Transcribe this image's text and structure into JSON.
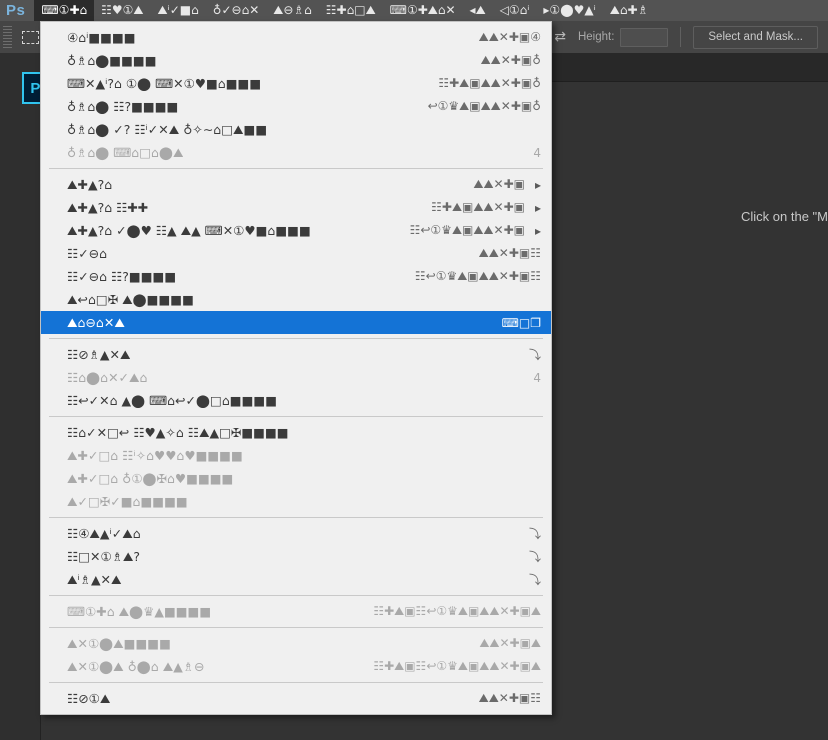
{
  "app": {
    "wordmark": "Ps",
    "home_button_label": "Ps"
  },
  "menubar": {
    "items": [
      {
        "label": "⌨①✚⌂",
        "active": true
      },
      {
        "label": "☷♥①⛰",
        "active": false
      },
      {
        "label": "⛰ⁱ✓■⌂",
        "active": false
      },
      {
        "label": "♁✓⊖⌂✕",
        "active": false
      },
      {
        "label": "⛰⊖♗⌂",
        "active": false
      },
      {
        "label": "☷✚⌂□⛰",
        "active": false
      },
      {
        "label": "⌨①✚⛰⌂✕",
        "active": false
      },
      {
        "label": "◂⛰",
        "active": false
      },
      {
        "label": "◁①⌂ⁱ",
        "active": false
      },
      {
        "label": "▸①⬤♥▲ⁱ",
        "active": false
      },
      {
        "label": "⛰⌂✚♗",
        "active": false
      }
    ]
  },
  "optionsbar": {
    "grip_icon": "drag-grip-icon",
    "tool_icon": "rectangular-marquee-icon",
    "width_value": "",
    "swap_icon": "⇄",
    "height_label": "Height:",
    "height_value": "",
    "select_and_mask_label": "Select and Mask..."
  },
  "canvas": {
    "hint_text": "Click on the \"M"
  },
  "menu": {
    "groups": [
      {
        "items": [
          {
            "label": "④⌂ⁱ■■■■",
            "shortcut": "⛰⛰✕✚▣④",
            "disabled": false,
            "submenu": false
          },
          {
            "label": "♁♗⌂⬤■■■■",
            "shortcut": "⛰⛰✕✚▣♁",
            "disabled": false,
            "submenu": false
          },
          {
            "label": "⌨✕▲ⁱ?⌂ ①⬤ ⌨✕①♥■⌂■■■",
            "shortcut": "☷✚⛰▣⛰⛰✕✚▣♁",
            "disabled": false,
            "submenu": false
          },
          {
            "label": "♁♗⌂⬤ ☷?■■■■",
            "shortcut": "↩①♛⛰▣⛰⛰✕✚▣♁",
            "disabled": false,
            "submenu": false
          },
          {
            "label": "♁♗⌂⬤ ✓? ☷ⁱ✓✕⛰ ♁✧∼⌂□⛰■■",
            "shortcut": "",
            "disabled": false,
            "submenu": false
          },
          {
            "label": "♁♗⌂⬤ ⌨⌂□⌂⬤⛰",
            "shortcut": "4",
            "disabled": true,
            "submenu": false
          }
        ]
      },
      {
        "items": [
          {
            "label": "⛰✚▲?⌂",
            "shortcut": "⛰⛰✕✚▣",
            "disabled": false,
            "submenu": true
          },
          {
            "label": "⛰✚▲?⌂ ☷✚✚",
            "shortcut": "☷✚⛰▣⛰⛰✕✚▣",
            "disabled": false,
            "submenu": true
          },
          {
            "label": "⛰✚▲?⌂ ✓⬤♥ ☷▲ ⛰▲ ⌨✕①♥■⌂■■■",
            "shortcut": "☷↩①♛⛰▣⛰⛰✕✚▣",
            "disabled": false,
            "submenu": true
          },
          {
            "label": "☷✓⊖⌂",
            "shortcut": "⛰⛰✕✚▣☷",
            "disabled": false,
            "submenu": false
          },
          {
            "label": "☷✓⊖⌂ ☷?■■■■",
            "shortcut": "☷↩①♛⛰▣⛰⛰✕✚▣☷",
            "disabled": false,
            "submenu": false
          },
          {
            "label": "⛰↩⌂□✠ ⛰⬤■■■■",
            "shortcut": "",
            "disabled": false,
            "submenu": false
          },
          {
            "label": "⛰⌂⊖⌂✕⛰",
            "shortcut": "⌨□❐",
            "disabled": false,
            "submenu": false,
            "selected": true
          }
        ]
      },
      {
        "items": [
          {
            "label": "☷⊘♗▲✕⛰",
            "shortcut": "⤵",
            "disabled": false,
            "submenu": false
          },
          {
            "label": "☷⌂⬤⌂✕✓⛰⌂",
            "shortcut": "4",
            "disabled": true,
            "submenu": false
          },
          {
            "label": "☷↩✓✕⌂ ▲⬤ ⌨⌂↩✓⬤□⌂■■■■",
            "shortcut": "",
            "disabled": false,
            "submenu": false
          }
        ]
      },
      {
        "items": [
          {
            "label": "☷⌂✓✕□↩ ☷♥▲✧⌂ ☷⛰▲□✠■■■■",
            "shortcut": "",
            "disabled": false,
            "submenu": false
          },
          {
            "label": "⛰✚✓□⌂ ☷ⁱ✧⌂♥♥⌂♥■■■■",
            "shortcut": "",
            "disabled": true,
            "submenu": false
          },
          {
            "label": "⛰✚✓□⌂ ♁①⬤✠⌂♥■■■■",
            "shortcut": "",
            "disabled": true,
            "submenu": false
          },
          {
            "label": "⛰✓□✠✓■⌂■■■■",
            "shortcut": "",
            "disabled": true,
            "submenu": false
          }
        ]
      },
      {
        "items": [
          {
            "label": "☷④⛰▲ⁱ✓⛰⌂",
            "shortcut": "⤵",
            "disabled": false,
            "submenu": false
          },
          {
            "label": "☷□✕①♗⛰?",
            "shortcut": "⤵",
            "disabled": false,
            "submenu": false
          },
          {
            "label": "⛰ⁱ♗▲✕⛰",
            "shortcut": "⤵",
            "disabled": false,
            "submenu": false
          }
        ]
      },
      {
        "items": [
          {
            "label": "⌨①✚⌂ ⛰⬤♛▲■■■■",
            "shortcut": "☷✚⛰▣☷↩①♛⛰▣⛰⛰✕✚▣⛰",
            "disabled": true,
            "submenu": false
          }
        ]
      },
      {
        "items": [
          {
            "label": "⛰✕①⬤⛰■■■■",
            "shortcut": "⛰⛰✕✚▣⛰",
            "disabled": true,
            "submenu": false
          },
          {
            "label": "⛰✕①⬤⛰ ♁⬤⌂ ⛰▲♗⊖",
            "shortcut": "☷✚⛰▣☷↩①♛⛰▣⛰⛰✕✚▣⛰",
            "disabled": true,
            "submenu": false
          }
        ]
      },
      {
        "items": [
          {
            "label": "☷⊘①⛰",
            "shortcut": "⛰⛰✕✚▣☷",
            "disabled": false,
            "submenu": false
          }
        ]
      }
    ]
  }
}
